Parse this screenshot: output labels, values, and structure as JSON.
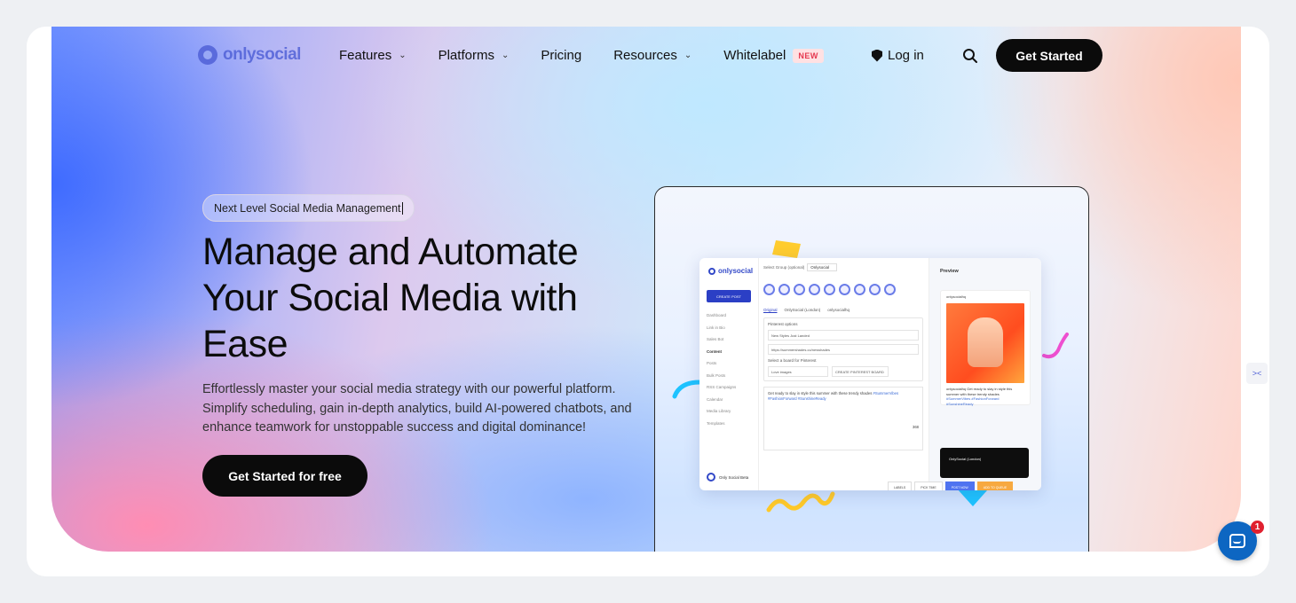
{
  "brand": {
    "name": "onlysocial"
  },
  "nav": {
    "items": [
      {
        "label": "Features",
        "dropdown": true
      },
      {
        "label": "Platforms",
        "dropdown": true
      },
      {
        "label": "Pricing",
        "dropdown": false
      },
      {
        "label": "Resources",
        "dropdown": true
      },
      {
        "label": "Whitelabel",
        "dropdown": false,
        "badge": "NEW"
      }
    ],
    "login_label": "Log in",
    "get_started_label": "Get Started"
  },
  "hero": {
    "tag": "Next Level Social Media Management",
    "headline": "Manage and Automate Your Social Media with Ease",
    "subtext": "Effortlessly master your social media strategy with our powerful platform. Simplify scheduling, gain in-depth analytics, build AI-powered chatbots, and enhance teamwork for unstoppable success and digital dominance!",
    "cta_label": "Get Started for free"
  },
  "app_preview": {
    "logo": "onlysocial",
    "create_post": "CREATE POST",
    "sidebar": [
      "Dashboard",
      "Link in Bio",
      "Sales Bot",
      "Content",
      "Posts",
      "Bulk Posts",
      "RSS Campaigns",
      "Calendar",
      "Media Library",
      "Templates"
    ],
    "account": "Only Social Beta",
    "select_group_label": "Select Group (optional)",
    "select_group_value": "Onlysocial",
    "tabs": [
      "Original",
      "OnlySocial (London)",
      "onlysocialhq"
    ],
    "pinterest_options": "Pinterest options",
    "title_value": "New Styles Just Landed",
    "url_value": "https://summershades.co/newshades",
    "board_label": "Select a board for Pinterest",
    "board_value": "Love images",
    "create_board": "CREATE PINTEREST BOARD",
    "post_text": "Get ready to slay in style this summer with these trendy shades",
    "post_tags": "#SummerVibes #FashionForward #SunshineReady",
    "char_count": "368",
    "preview_title": "Preview",
    "preview_handle": "onlysocialhq",
    "preview_caption": "onlysocialhq Get ready to slay in style this summer with these trendy shades",
    "preview_tags": "#SummerVibes #FashionForward #SunshineReady",
    "fb_account": "OnlySocial (London)",
    "actions": [
      "LABELS",
      "PICK TIME",
      "POST NOW",
      "ADD TO QUEUE"
    ]
  },
  "widgets": {
    "chat_badge": "1"
  },
  "colors": {
    "accent": "#4c5dd6",
    "cta": "#0b0b0b",
    "new_badge": "#e53950",
    "chat": "#0d66c2"
  }
}
